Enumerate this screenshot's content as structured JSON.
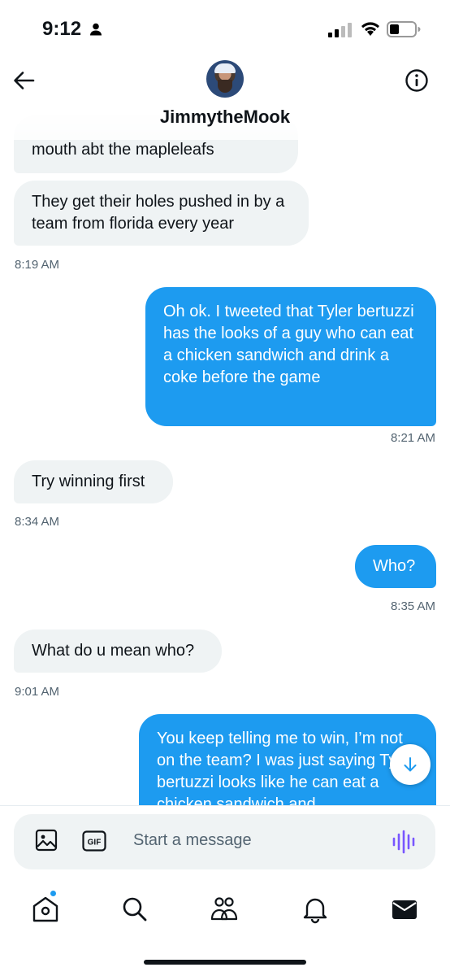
{
  "status_bar": {
    "time": "9:12"
  },
  "header": {
    "contact_name": "JimmytheMook"
  },
  "messages": [
    {
      "from": "them",
      "text": "mouth abt the mapleleafs"
    },
    {
      "from": "them",
      "text": "They get their holes pushed in by a team from florida every year",
      "time": "8:19 AM"
    },
    {
      "from": "me",
      "text": "Oh ok. I tweeted that Tyler bertuzzi has the looks of a guy who can eat a chicken sandwich and  drink a coke before the game",
      "time": "8:21 AM"
    },
    {
      "from": "them",
      "text": "Try winning first",
      "time": "8:34 AM"
    },
    {
      "from": "me",
      "text": "Who?",
      "time": "8:35 AM"
    },
    {
      "from": "them",
      "text": "What do u mean who?",
      "time": "9:01 AM"
    },
    {
      "from": "me",
      "text": "You keep telling me to win, I’m not on the team? I was just saying Tyler bertuzzi looks like he can eat a chicken sandwich and"
    }
  ],
  "composer": {
    "placeholder": "Start a message",
    "gif_label": "GIF"
  },
  "tabs": [
    "home",
    "search",
    "communities",
    "notifications",
    "messages"
  ],
  "colors": {
    "accent": "#1d9bf0",
    "received_bubble": "#eff3f4",
    "voice_icon": "#7856ff"
  }
}
